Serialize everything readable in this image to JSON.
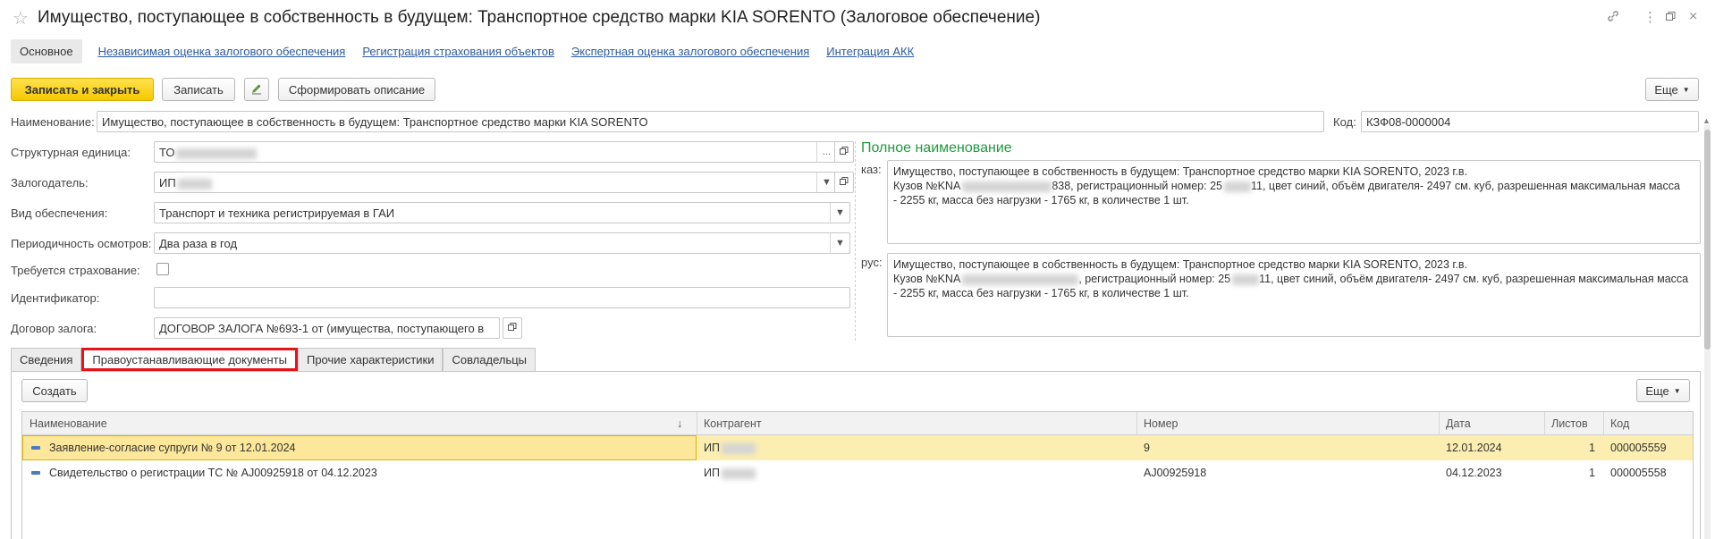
{
  "window": {
    "title": "Имущество, поступающее в собственность в будущем: Транспортное средство марки KIA SORENTO (Залоговое обеспечение)"
  },
  "nav": {
    "main": "Основное",
    "links": [
      "Независимая оценка залогового обеспечения",
      "Регистрация страхования объектов",
      "Экспертная оценка залогового обеспечения",
      "Интеграция АКК"
    ]
  },
  "toolbar": {
    "save_close": "Записать и закрыть",
    "save": "Записать",
    "form_description": "Сформировать описание",
    "more": "Еще"
  },
  "form": {
    "name_label": "Наименование:",
    "name_value": "Имущество, поступающее в собственность в будущем: Транспортное средство марки KIA SORENTO",
    "code_label": "Код:",
    "code_value": "КЗФ08-0000004",
    "struct_unit_label": "Структурная единица:",
    "struct_unit_value": "ТО",
    "pledger_label": "Залогодатель:",
    "pledger_value": "ИП",
    "collateral_type_label": "Вид обеспечения:",
    "collateral_type_value": "Транспорт и техника регистрируемая в ГАИ",
    "inspection_label": "Периодичность осмотров:",
    "inspection_value": "Два раза в год",
    "insurance_label": "Требуется страхование:",
    "identifier_label": "Идентификатор:",
    "identifier_value": "",
    "contract_label": "Договор залога:",
    "contract_value": "ДОГОВОР ЗАЛОГА  №693-1 от   (имущества, поступающего в"
  },
  "full_name": {
    "title": "Полное наименование",
    "kaz_label": "каз:",
    "kaz_line1": "Имущество, поступающее в собственность в будущем: Транспортное средство марки KIA SORENTO, 2023 г.в.",
    "kaz_line2a": "Кузов №KNA",
    "kaz_line2b": "838, регистрационный номер: 25",
    "kaz_line2c": "11, цвет синий, объём двигателя-  2497 см. куб, разрешенная максимальная масса",
    "kaz_line3": "- 2255 кг, масса без нагрузки - 1765 кг, в количестве 1 шт.",
    "rus_label": "рус:",
    "rus_line1": "Имущество, поступающее в собственность в будущем: Транспортное средство марки KIA SORENTO, 2023 г.в.",
    "rus_line2a": "Кузов №KNA",
    "rus_line2b": ", регистрационный номер: 25",
    "rus_line2c": "11, цвет синий, объём двигателя-  2497 см. куб, разрешенная максимальная масса",
    "rus_line3": "- 2255 кг, масса без нагрузки - 1765 кг, в количестве 1 шт."
  },
  "tabs": [
    "Сведения",
    "Правоустанавливающие документы",
    "Прочие характеристики",
    "Совладельцы"
  ],
  "panel": {
    "create": "Создать",
    "more": "Еще"
  },
  "table": {
    "columns": [
      "Наименование",
      "Контрагент",
      "Номер",
      "Дата",
      "Листов",
      "Код"
    ],
    "sort_indicator": "↓",
    "rows": [
      {
        "name": "Заявление-согласие супруги № 9 от 12.01.2024",
        "counterparty": "ИП",
        "number": "9",
        "date": "12.01.2024",
        "sheets": "1",
        "code": "000005559"
      },
      {
        "name": "Свидетельство о регистрации ТС № AJ00925918 от 04.12.2023",
        "counterparty": "ИП",
        "number": "AJ00925918",
        "date": "04.12.2023",
        "sheets": "1",
        "code": "000005558"
      }
    ]
  },
  "colors": {
    "primary_button": "#f5c800",
    "link": "#2b5aa0",
    "full_name_title": "#1e9b3a",
    "selected_row": "#fbeeb0",
    "highlight": "#e4141b"
  }
}
